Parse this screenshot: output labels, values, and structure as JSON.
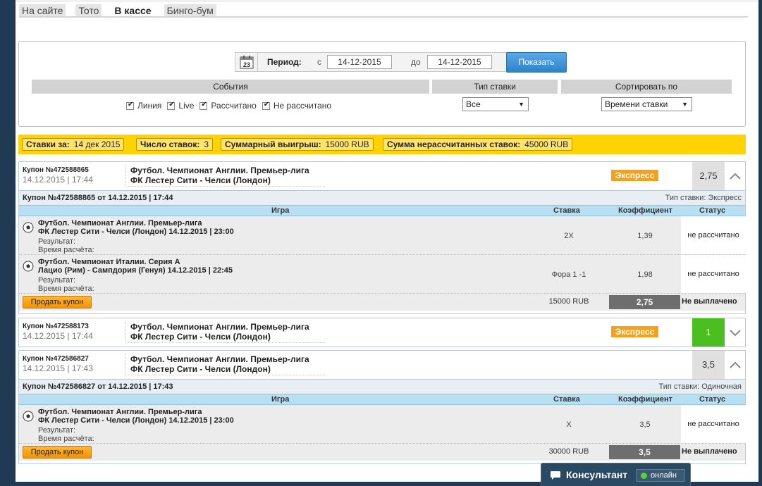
{
  "tabs": [
    "На сайте",
    "Тото",
    "В кассе",
    "Бинго-бум"
  ],
  "filters": {
    "period_label": "Период:",
    "from_label": "с",
    "from_value": "14-12-2015",
    "to_label": "до",
    "to_value": "14-12-2015",
    "show_button": "Показать",
    "calendar_day": "23",
    "events_header": "События",
    "bet_type_header": "Тип ставки",
    "sort_header": "Сортировать по",
    "checkboxes": [
      "Линия",
      "Live",
      "Рассчитано",
      "Не рассчитано"
    ],
    "bet_type_value": "Все",
    "sort_value": "Времени ставки"
  },
  "summary": {
    "bets_for_label": "Ставки за:",
    "bets_for_value": "14 дек 2015",
    "count_label": "Число ставок:",
    "count_value": "3",
    "total_win_label": "Суммарный выигрыш:",
    "total_win_value": "15000 RUB",
    "unsettled_label": "Сумма нерассчитанных ставок:",
    "unsettled_value": "45000 RUB"
  },
  "table_headers": {
    "game": "Игра",
    "bet": "Ставка",
    "coef": "Коэффициент",
    "status": "Статус"
  },
  "coupons": [
    {
      "number": "Купон №472588865",
      "date": "14.12.2015 | 17:44",
      "event_line1": "Футбол. Чемпионат Англии. Премьер-лига",
      "event_line2": "ФК Лестер Сити - Челси (Лондон)",
      "badge": "Экспресс",
      "odds": "2,75",
      "detail_title": "Купон №472588865 от 14.12.2015 | 17:44",
      "detail_type": "Тип ставки: Экспресс",
      "rows": [
        {
          "l1": "Футбол. Чемпионат Англии. Премьер-лига",
          "l2": "ФК Лестер Сити - Челси (Лондон) 14.12.2015 | 23:00",
          "l3": "Результат:",
          "l4": "Время расчёта:",
          "bet": "2X",
          "coef": "1,39",
          "status": "не рассчитано"
        },
        {
          "l1": "Футбол. Чемпионат Италии. Серия А",
          "l2": "Лацио (Рим) - Сампдория (Генуя) 14.12.2015 | 22:45",
          "l3": "Результат:",
          "l4": "Время расчёта:",
          "bet": "Фора 1 -1",
          "coef": "1,98",
          "status": "не рассчитано"
        }
      ],
      "sell_button": "Продать купон",
      "footer_sum": "15000 RUB",
      "footer_coef": "2,75",
      "footer_status": "Не выплачено"
    },
    {
      "number": "Купон №472588173",
      "date": "14.12.2015 | 17:44",
      "event_line1": "Футбол. Чемпионат Англии. Премьер-лига",
      "event_line2": "ФК Лестер Сити - Челси (Лондон)",
      "badge": "Экспресс",
      "odds": "1"
    },
    {
      "number": "Купон №472586827",
      "date": "14.12.2015 | 17:43",
      "event_line1": "Футбол. Чемпионат Англии. Премьер-лига",
      "event_line2": "ФК Лестер Сити - Челси (Лондон)",
      "odds": "3,5",
      "detail_title": "Купон №472586827 от 14.12.2015 | 17:43",
      "detail_type": "Тип ставки: Одиночная",
      "rows": [
        {
          "l1": "Футбол. Чемпионат Англии. Премьер-лига",
          "l2": "ФК Лестер Сити - Челси (Лондон) 14.12.2015 | 23:00",
          "l3": "Результат:",
          "l4": "Время расчёта:",
          "bet": "X",
          "coef": "3,5",
          "status": "не рассчитано"
        }
      ],
      "sell_button": "Продать купон",
      "footer_sum": "30000 RUB",
      "footer_coef": "3,5",
      "footer_status": "Не выплачено"
    }
  ],
  "consultant": {
    "label": "Консультант",
    "status": "онлайн"
  },
  "colors": {
    "summary_bar": "#ffd200",
    "express_badge": "#f5a21a",
    "odds_green": "#4cbe1f",
    "table_header": "#b9dff3",
    "show_button": "#2d83c9"
  },
  "icons": [
    "calendar-icon",
    "checkbox-icon",
    "chevron-up-icon",
    "chevron-down-icon",
    "soccer-ball-icon",
    "chat-bubble-icon",
    "online-dot-icon"
  ]
}
